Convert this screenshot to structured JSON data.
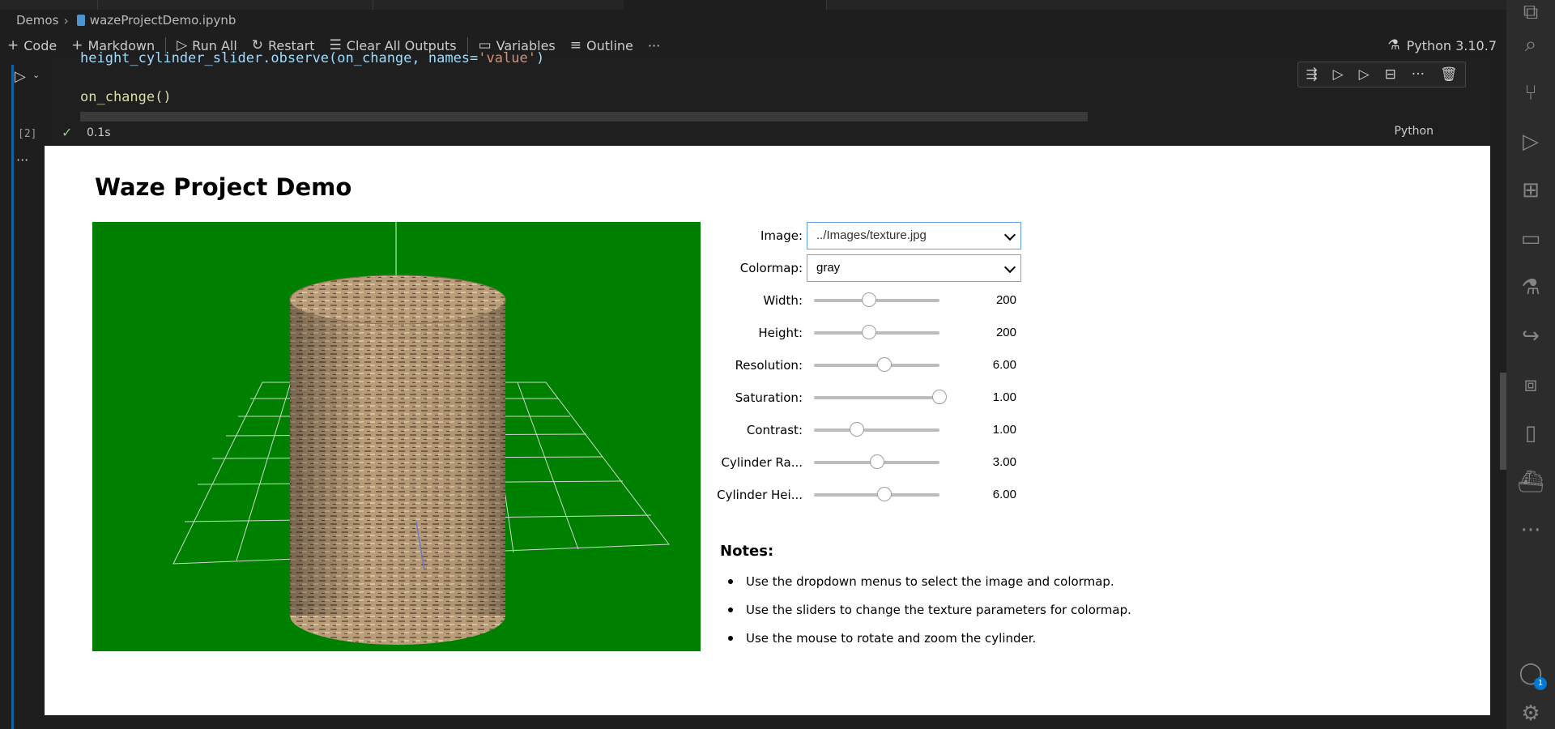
{
  "breadcrumb": {
    "folder": "Demos",
    "file": "wazeProjectDemo.ipynb"
  },
  "toolbar": {
    "code": "Code",
    "markdown": "Markdown",
    "run_all": "Run All",
    "restart": "Restart",
    "clear_outputs": "Clear All Outputs",
    "variables": "Variables",
    "outline": "Outline",
    "more": "···",
    "kernel": "Python 3.10.7"
  },
  "cell": {
    "code_line1_a": "height_cylinder_slider.observe(on_change, names=",
    "code_line1_b": "'value'",
    "code_line1_c": ")",
    "code_line2": "on_change()",
    "exec_count": "[2]",
    "exec_time": "0.1s",
    "language": "Python"
  },
  "output": {
    "title": "Waze Project Demo",
    "image_label": "Image:",
    "image_value": "../Images/texture.jpg",
    "colormap_label": "Colormap:",
    "colormap_value": "gray",
    "sliders": [
      {
        "label": "Width:",
        "value": "200",
        "fraction": 0.44
      },
      {
        "label": "Height:",
        "value": "200",
        "fraction": 0.44
      },
      {
        "label": "Resolution:",
        "value": "6.00",
        "fraction": 0.56
      },
      {
        "label": "Saturation:",
        "value": "1.00",
        "fraction": 1.0
      },
      {
        "label": "Contrast:",
        "value": "1.00",
        "fraction": 0.34
      },
      {
        "label": "Cylinder Ra...",
        "value": "3.00",
        "fraction": 0.5
      },
      {
        "label": "Cylinder Hei...",
        "value": "6.00",
        "fraction": 0.56
      }
    ],
    "notes_title": "Notes:",
    "notes": [
      "Use the dropdown menus to select the image and colormap.",
      "Use the sliders to change the texture parameters for colormap.",
      "Use the mouse to rotate and zoom the cylinder."
    ]
  },
  "activity": {
    "accounts_badge": "1"
  }
}
